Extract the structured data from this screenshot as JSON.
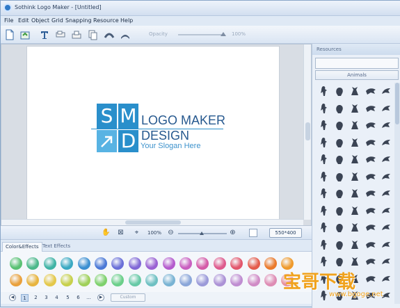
{
  "window": {
    "title": "Sothink Logo Maker - [Untitled]"
  },
  "menu": [
    "File",
    "Edit",
    "Object",
    "Grid",
    "Snapping",
    "Resource",
    "Help"
  ],
  "toolbar": {
    "opacity_label": "Opacity",
    "opacity_value": "100%",
    "opacity_level": 1.0
  },
  "logo": {
    "letters": [
      "S",
      "M",
      "D"
    ],
    "line1": "LOGO MAKER",
    "line2": "DESIGN",
    "slogan": "Your Slogan Here",
    "color_primary": "#2a8fcb",
    "color_text": "#27598f"
  },
  "status": {
    "zoom": "100%",
    "canvas_size": "550*400"
  },
  "tabs": [
    {
      "label": "Color&Effects",
      "active": true
    },
    {
      "label": "Text Effects",
      "active": false
    }
  ],
  "swatches": {
    "row1": [
      "#59c173",
      "#4cb88a",
      "#3fb3a5",
      "#3aa9c2",
      "#3b8fd1",
      "#4a78d6",
      "#6a6fd8",
      "#8168d6",
      "#9a62d3",
      "#b45bcd",
      "#c95fc0",
      "#d45aa8",
      "#de5a8d",
      "#e2566c",
      "#e45b4b",
      "#ea7a2c",
      "#ef9a2c"
    ],
    "row2": [
      "#e9a03c",
      "#e7b43f",
      "#e4c84a",
      "#c7d04c",
      "#9fd05a",
      "#7ed16d",
      "#6bcf8a",
      "#67c9a6",
      "#6ec0c2",
      "#79b3d3",
      "#8aa6d9",
      "#9b9ad9",
      "#ac92d6",
      "#bf8dd1",
      "#d08bc6",
      "#de8cb4",
      "#e78f9c"
    ]
  },
  "pager": {
    "pages": [
      "1",
      "2",
      "3",
      "4",
      "5",
      "6"
    ],
    "ellipsis": "...",
    "selected": "1",
    "custom_label": "Custom"
  },
  "resources": {
    "header": "Resources",
    "search_value": "",
    "category": "Animals"
  },
  "watermark": {
    "text": "宝哥下载",
    "url": "www.bgoge.net"
  }
}
